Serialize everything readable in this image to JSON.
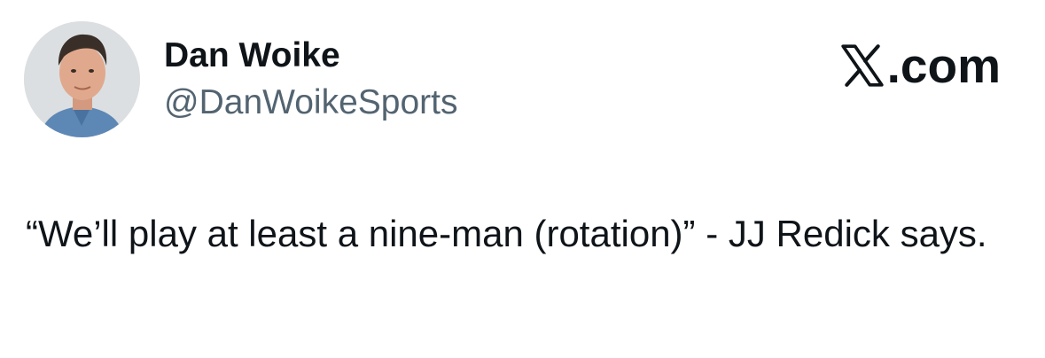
{
  "author": {
    "display_name": "Dan Woike",
    "handle": "@DanWoikeSports",
    "avatar_icon": "profile-photo"
  },
  "brand": {
    "icon": "x-logo-icon",
    "label": ".com"
  },
  "tweet": {
    "text": "“We’ll play at least a nine-man (rotation)” - JJ Redick says."
  },
  "colors": {
    "text": "#0f1419",
    "secondary_text": "#536471",
    "background": "#ffffff"
  }
}
